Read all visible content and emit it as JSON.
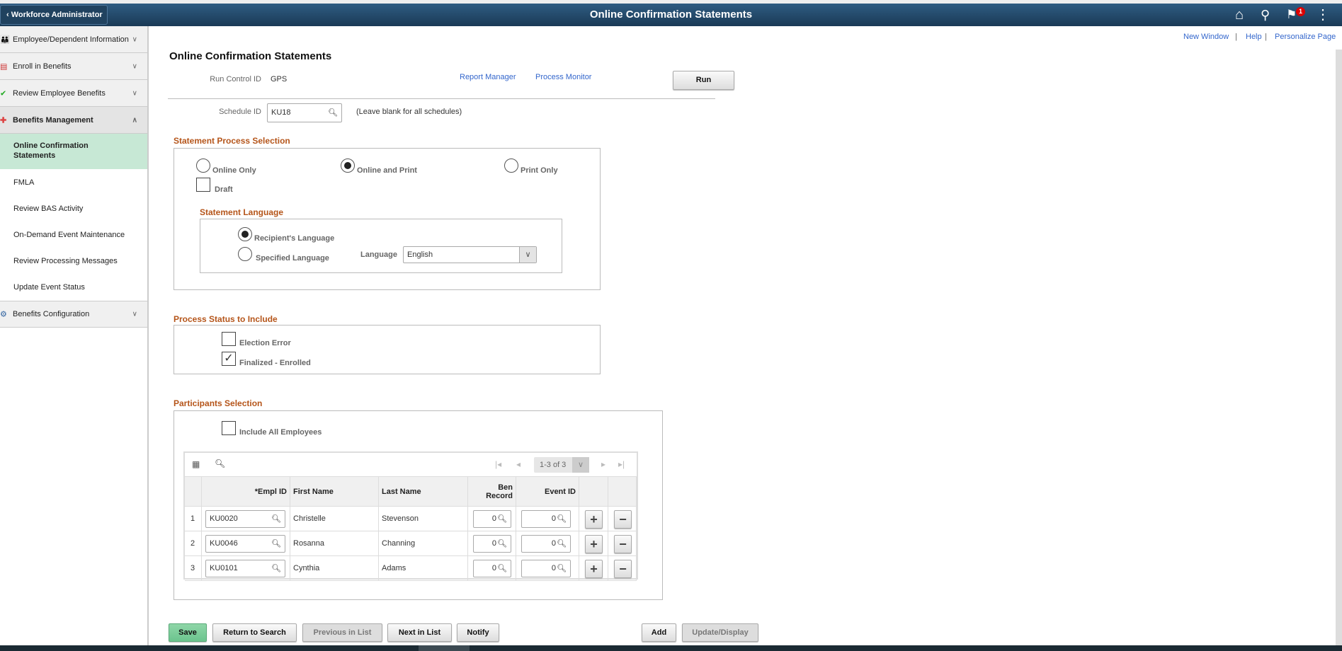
{
  "header": {
    "back_label": "Workforce Administrator",
    "title": "Online Confirmation Statements",
    "notification_count": "1",
    "icons": [
      "home-icon",
      "search-icon",
      "flag-icon",
      "more-icon"
    ]
  },
  "sidebar": {
    "groups": [
      {
        "label": "Employee/Dependent Information"
      },
      {
        "label": "Enroll in Benefits"
      },
      {
        "label": "Review Employee Benefits"
      },
      {
        "label": "Benefits Management"
      },
      {
        "label": "Benefits Configuration"
      }
    ],
    "sub_items": [
      {
        "label": "Online Confirmation Statements"
      },
      {
        "label": "FMLA"
      },
      {
        "label": "Review BAS Activity"
      },
      {
        "label": "On-Demand Event Maintenance"
      },
      {
        "label": "Review Processing Messages"
      },
      {
        "label": "Update Event Status"
      }
    ]
  },
  "links": {
    "new_window": "New Window",
    "help": "Help",
    "personalize": "Personalize Page",
    "sep": "|"
  },
  "page": {
    "title": "Online Confirmation Statements",
    "run_control_label": "Run Control ID",
    "run_control_value": "GPS",
    "report_manager": "Report Manager",
    "process_monitor": "Process Monitor",
    "run": "Run",
    "schedule_label": "Schedule ID",
    "schedule_value": "KU18",
    "schedule_hint": "(Leave blank for all schedules)"
  },
  "statement": {
    "header": "Statement Process Selection",
    "online_only": "Online Only",
    "online_print": "Online and Print",
    "print_only": "Print Only",
    "selected": "Online and Print",
    "draft": "Draft",
    "draft_checked": false,
    "lang_header": "Statement Language",
    "recipient": "Recipient's Language",
    "specified": "Specified Language",
    "lang_selected": "Recipient's Language",
    "language_label": "Language",
    "language_value": "English"
  },
  "status": {
    "header": "Process Status to Include",
    "election_error": "Election Error",
    "election_error_checked": false,
    "finalized": "Finalized - Enrolled",
    "finalized_checked": true
  },
  "participants": {
    "header": "Participants Selection",
    "include_all": "Include All Employees",
    "include_all_checked": false,
    "pagination": "1-3 of 3",
    "columns": {
      "empl": "*Empl ID",
      "first": "First Name",
      "last": "Last Name",
      "ben": "Ben Record",
      "event": "Event ID"
    },
    "rows": [
      {
        "n": "1",
        "empl": "KU0020",
        "first": "Christelle",
        "last": "Stevenson",
        "ben": "0",
        "event": "0"
      },
      {
        "n": "2",
        "empl": "KU0046",
        "first": "Rosanna",
        "last": "Channing",
        "ben": "0",
        "event": "0"
      },
      {
        "n": "3",
        "empl": "KU0101",
        "first": "Cynthia",
        "last": "Adams",
        "ben": "0",
        "event": "0"
      }
    ]
  },
  "footer": {
    "save": "Save",
    "return": "Return to Search",
    "previous": "Previous in List",
    "next": "Next in List",
    "notify": "Notify",
    "add": "Add",
    "update": "Update/Display"
  }
}
